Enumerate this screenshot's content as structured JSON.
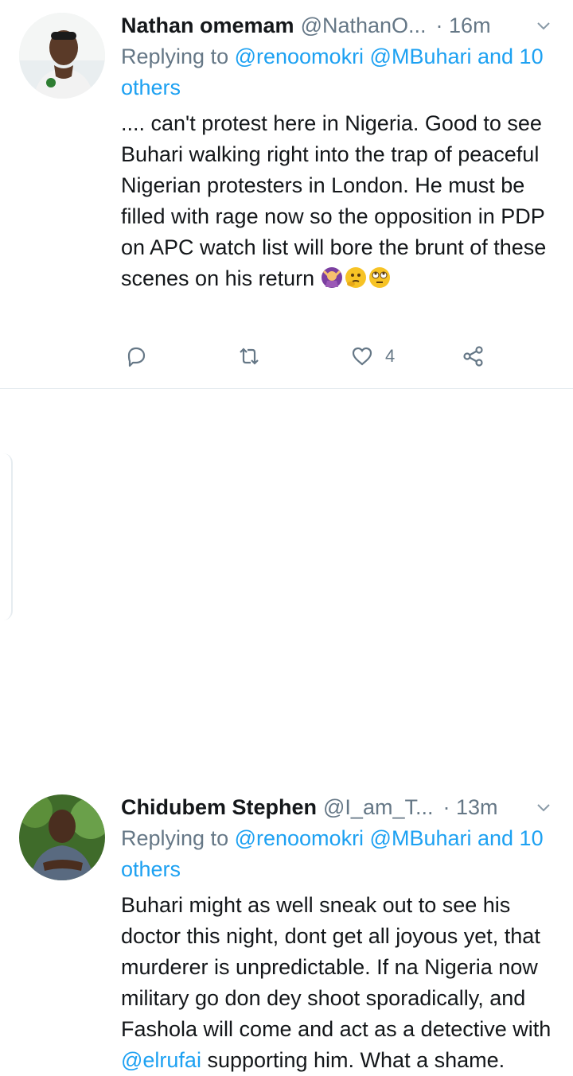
{
  "tweets": [
    {
      "name": "Nathan omemam",
      "handle": "@NathanO...",
      "time": "· 16m",
      "replying_prefix": "Replying to ",
      "replying_mentions": "@renoomokri @MBuhari and 10 others",
      "body": ".... can't protest here in Nigeria. Good to see Buhari walking right into the trap of peaceful Nigerian protesters in London. He must be filled with rage now so the opposition in PDP on APC watch list will bore the brunt of these scenes on his return",
      "likes": "4"
    },
    {
      "name": "Chidubem Stephen",
      "handle": "@I_am_T...",
      "time": "· 13m",
      "replying_prefix": "Replying to ",
      "replying_mentions": "@renoomokri @MBuhari and 10 others",
      "body_before": "Buhari might as well sneak out to see his doctor this night, dont get all joyous yet, that murderer is unpredictable. If na Nigeria now military go don dey shoot sporadically, and Fashola will come and act as a detective with ",
      "body_mention": "@elrufai",
      "body_after": " supporting him. What a shame."
    }
  ],
  "icons": [
    "reply-icon",
    "retweet-icon",
    "like-icon",
    "share-icon",
    "chevron-down-icon"
  ],
  "colors": {
    "link": "#1da1f2",
    "muted": "#657786",
    "text": "#14171a",
    "divider": "#e6ecf0"
  }
}
